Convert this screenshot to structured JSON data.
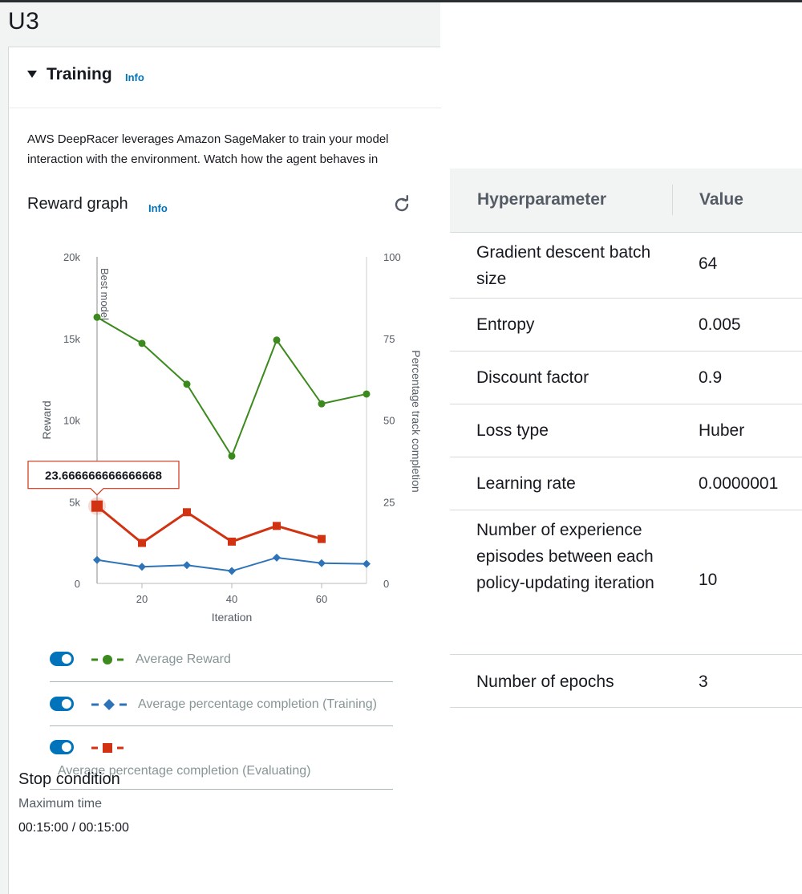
{
  "page": {
    "title": "U3"
  },
  "training": {
    "title": "Training",
    "info": "Info",
    "description_line1": "AWS DeepRacer leverages Amazon SageMaker to train your model",
    "description_line2": "interaction with the environment. Watch how the agent behaves in"
  },
  "reward_graph": {
    "title": "Reward graph",
    "info": "Info",
    "refresh_icon": "refresh-icon"
  },
  "chart_data": {
    "type": "line",
    "xlabel": "Iteration",
    "ylabel": "Reward",
    "ylabel_right": "Percentage track completion",
    "xlim": [
      10,
      70
    ],
    "ylim": [
      0,
      20000
    ],
    "ylim_right": [
      0,
      100
    ],
    "x_ticks": [
      20,
      40,
      60
    ],
    "y_ticks": [
      0,
      5000,
      10000,
      15000,
      20000
    ],
    "y_tick_labels": [
      "0",
      "5k",
      "10k",
      "15k",
      "20k"
    ],
    "y_right_ticks": [
      0,
      25,
      50,
      75,
      100
    ],
    "best_model_label": "Best model",
    "best_model_x": 10,
    "tooltip": {
      "text": "23.666666666666668",
      "series": 2,
      "index": 0
    },
    "series": [
      {
        "name": "Average Reward",
        "axis": "left",
        "color": "#3c8a1e",
        "marker": "circle",
        "x": [
          10,
          20,
          30,
          40,
          50,
          60,
          70
        ],
        "y": [
          16300,
          14700,
          12200,
          7800,
          14900,
          11000,
          11600
        ]
      },
      {
        "name": "Average percentage completion (Training)",
        "axis": "right",
        "color": "#2e73b8",
        "marker": "diamond",
        "x": [
          10,
          20,
          30,
          40,
          50,
          60,
          70
        ],
        "y": [
          7.2,
          5.1,
          5.6,
          3.8,
          7.9,
          6.2,
          6.0
        ]
      },
      {
        "name": "Average percentage completion (Evaluating)",
        "axis": "right",
        "color": "#d13212",
        "marker": "square",
        "x": [
          10,
          20,
          30,
          40,
          50,
          60
        ],
        "y": [
          23.666666666666668,
          12.4,
          21.8,
          12.8,
          17.6,
          13.6
        ]
      }
    ]
  },
  "legend": [
    {
      "label": "Average Reward",
      "color": "#3c8a1e",
      "marker": "circle"
    },
    {
      "label": "Average percentage completion (Training)",
      "color": "#2e73b8",
      "marker": "diamond"
    },
    {
      "label": "Average percentage completion (Evaluating)",
      "color": "#d13212",
      "marker": "square"
    }
  ],
  "stop_condition": {
    "title": "Stop condition",
    "label": "Maximum time",
    "value": "00:15:00 / 00:15:00"
  },
  "hyperparameters": {
    "col_name": "Hyperparameter",
    "col_value": "Value",
    "rows": [
      {
        "name": "Gradient descent batch size",
        "value": "64"
      },
      {
        "name": "Entropy",
        "value": "0.005"
      },
      {
        "name": "Discount factor",
        "value": "0.9"
      },
      {
        "name": "Loss type",
        "value": "Huber"
      },
      {
        "name": "Learning rate",
        "value": "0.0000001"
      },
      {
        "name": "Number of experience episodes between each policy-updating iteration",
        "value": "10"
      },
      {
        "name": "Number of epochs",
        "value": "3"
      }
    ]
  }
}
